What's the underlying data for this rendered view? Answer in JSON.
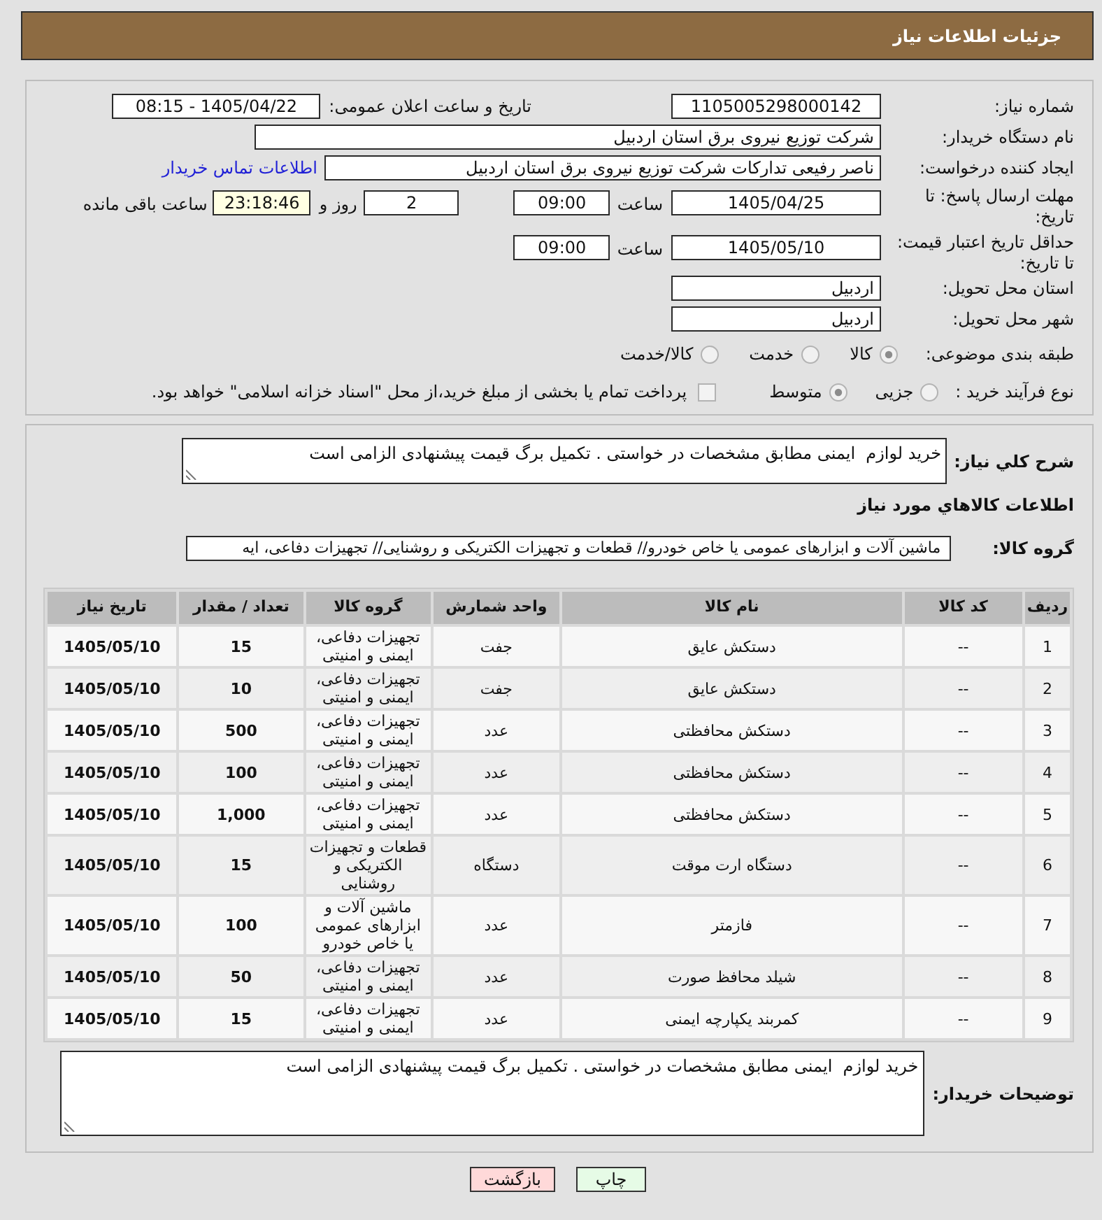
{
  "header": {
    "title": "جزئیات اطلاعات نیاز"
  },
  "details": {
    "need_number": {
      "label": "شماره نیاز:",
      "value": "1105005298000142"
    },
    "announcement": {
      "label": "تاریخ و ساعت اعلان عمومی:",
      "value": "1405/04/22 - 08:15"
    },
    "buyer_org": {
      "label": "نام دستگاه خریدار:",
      "value": "شرکت توزیع نیروی برق استان اردبیل"
    },
    "requester": {
      "label": "ایجاد کننده درخواست:",
      "value": "ناصر رفیعی تدارکات شرکت توزیع نیروی برق استان اردبیل",
      "link": "اطلاعات تماس خریدار"
    },
    "response_deadline": {
      "label": "مهلت ارسال پاسخ: تا تاریخ:",
      "date": "1405/04/25",
      "time_label": "ساعت",
      "time": "09:00",
      "days": "2",
      "days_label": "روز و",
      "remaining": "23:18:46",
      "remaining_label": "ساعت باقی مانده"
    },
    "price_validity": {
      "label": "حداقل تاریخ اعتبار قیمت: تا تاریخ:",
      "date": "1405/05/10",
      "time_label": "ساعت",
      "time": "09:00"
    },
    "delivery_province": {
      "label": "استان محل تحویل:",
      "value": "اردبیل"
    },
    "delivery_city": {
      "label": "شهر محل تحویل:",
      "value": "اردبیل"
    },
    "subject_category": {
      "label": "طبقه بندی موضوعی:",
      "options": [
        {
          "label": "کالا",
          "selected": true
        },
        {
          "label": "خدمت",
          "selected": false
        },
        {
          "label": "کالا/خدمت",
          "selected": false
        }
      ]
    },
    "purchase_process": {
      "label": "نوع فرآیند خرید :",
      "options": [
        {
          "label": "جزیی",
          "selected": false
        },
        {
          "label": "متوسط",
          "selected": true
        }
      ],
      "treasury_payment": {
        "label": "پرداخت تمام یا بخشی از مبلغ خرید،از محل \"اسناد خزانه اسلامی\" خواهد بود.",
        "checked": false
      }
    }
  },
  "description": {
    "label": "شرح کلي نیاز:",
    "value": "خرید لوازم  ایمنی مطابق مشخصات در خواستی . تکمیل برگ قیمت پیشنهادی الزامی است"
  },
  "goods_heading": "اطلاعات كالاهاي مورد نیاز",
  "goods_group": {
    "label": "گروه کالا:",
    "value": "ماشین آلات و ابزارهای عمومی یا خاص خودرو// قطعات و تجهیزات الکتریکی و روشنایی// تجهیزات دفاعی، ایه"
  },
  "table": {
    "columns": [
      "ردیف",
      "کد کالا",
      "نام کالا",
      "واحد شمارش",
      "گروه کالا",
      "تعداد / مقدار",
      "تاریخ نیاز"
    ],
    "rows": [
      [
        "1",
        "--",
        "دستکش عایق",
        "جفت",
        "تجهیزات دفاعی، ایمنی و امنیتی",
        "15",
        "1405/05/10"
      ],
      [
        "2",
        "--",
        "دستکش عایق",
        "جفت",
        "تجهیزات دفاعی، ایمنی و امنیتی",
        "10",
        "1405/05/10"
      ],
      [
        "3",
        "--",
        "دستکش محافظتی",
        "عدد",
        "تجهیزات دفاعی، ایمنی و امنیتی",
        "500",
        "1405/05/10"
      ],
      [
        "4",
        "--",
        "دستکش محافظتی",
        "عدد",
        "تجهیزات دفاعی، ایمنی و امنیتی",
        "100",
        "1405/05/10"
      ],
      [
        "5",
        "--",
        "دستکش محافظتی",
        "عدد",
        "تجهیزات دفاعی، ایمنی و امنیتی",
        "1,000",
        "1405/05/10"
      ],
      [
        "6",
        "--",
        "دستگاه ارت موقت",
        "دستگاه",
        "قطعات و تجهیزات الکتریکی و روشنایی",
        "15",
        "1405/05/10"
      ],
      [
        "7",
        "--",
        "فازمتر",
        "عدد",
        "ماشین آلات و ابزارهای عمومی یا خاص خودرو",
        "100",
        "1405/05/10"
      ],
      [
        "8",
        "--",
        "شیلد محافظ صورت",
        "عدد",
        "تجهیزات دفاعی، ایمنی و امنیتی",
        "50",
        "1405/05/10"
      ],
      [
        "9",
        "--",
        "کمربند یکپارچه ایمنی",
        "عدد",
        "تجهیزات دفاعی، ایمنی و امنیتی",
        "15",
        "1405/05/10"
      ]
    ]
  },
  "buyer_notes": {
    "label": "توضیحات خریدار:",
    "value": "خرید لوازم  ایمنی مطابق مشخصات در خواستی . تکمیل برگ قیمت پیشنهادی الزامی است"
  },
  "buttons": [
    {
      "label": "چاپ",
      "kind": "print"
    },
    {
      "label": "بازگشت",
      "kind": "back"
    }
  ]
}
